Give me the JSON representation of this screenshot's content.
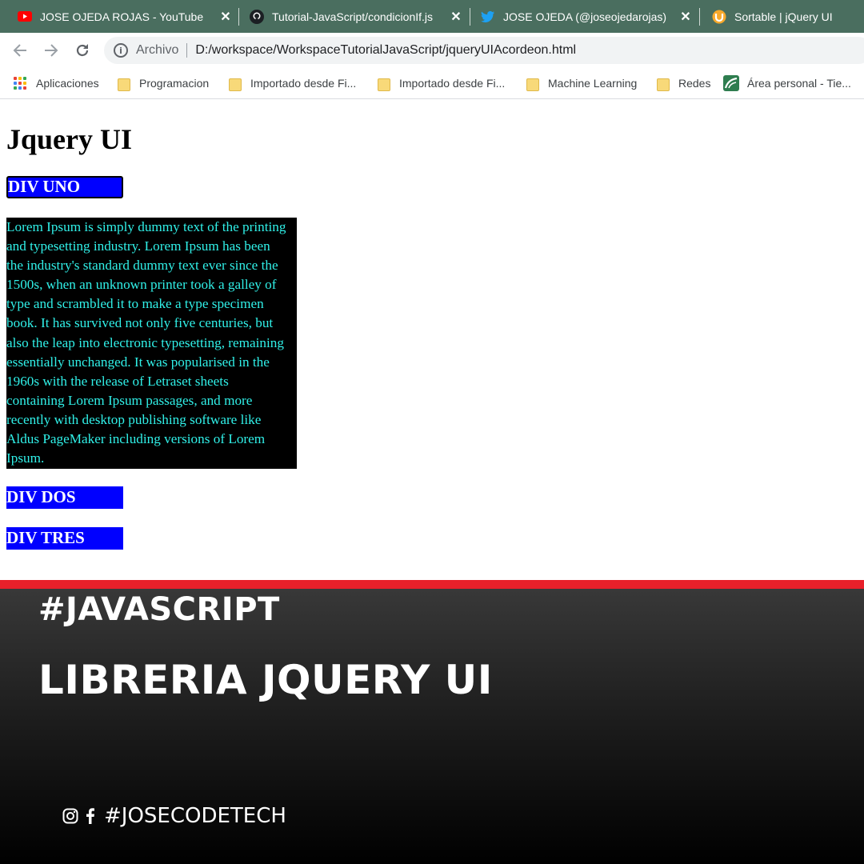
{
  "tabs": [
    {
      "title": "JOSE OJEDA ROJAS - YouTube",
      "icon": "youtube-icon"
    },
    {
      "title": "Tutorial-JavaScript/condicionIf.js",
      "icon": "github-icon"
    },
    {
      "title": "JOSE OJEDA (@joseojedarojas) / T",
      "icon": "twitter-icon"
    },
    {
      "title": "Sortable | jQuery UI",
      "icon": "jquery-ui-icon"
    }
  ],
  "address_bar": {
    "scheme_label": "Archivo",
    "url": "D:/workspace/WorkspaceTutorialJavaScript/jqueryUIAcordeon.html"
  },
  "bookmarks": [
    {
      "label": "Aplicaciones",
      "icon": "apps-grid-icon"
    },
    {
      "label": "Programacion",
      "icon": "folder-icon"
    },
    {
      "label": "Importado desde Fi...",
      "icon": "folder-icon"
    },
    {
      "label": "Importado desde Fi...",
      "icon": "folder-icon"
    },
    {
      "label": "Machine Learning",
      "icon": "folder-icon"
    },
    {
      "label": "Redes",
      "icon": "folder-icon"
    },
    {
      "label": "Área personal - Tie...",
      "icon": "moodle-icon"
    }
  ],
  "page": {
    "heading": "Jquery UI",
    "accordion": [
      {
        "header": "DIV UNO",
        "expanded": true
      },
      {
        "header": "DIV DOS",
        "expanded": false
      },
      {
        "header": "DIV TRES",
        "expanded": false
      }
    ],
    "panel_lines": [
      "Lorem Ipsum is simply dummy text of the printing",
      "and typesetting industry. Lorem Ipsum has been",
      "the industry's standard dummy text ever since the",
      "1500s, when an unknown printer took a galley of",
      "type and scrambled it to make a type specimen",
      "book. It has survived not only five centuries, but",
      "also the leap into electronic typesetting, remaining",
      "essentially unchanged. It was popularised in the",
      "1960s with the release of Letraset sheets",
      "containing Lorem Ipsum passages, and more",
      "recently with desktop publishing software like",
      "Aldus PageMaker including versions of Lorem",
      "Ipsum."
    ]
  },
  "banner": {
    "hashtag": "#JAVASCRIPT",
    "headline": "LIBRERIA JQUERY UI",
    "social_handle": "#JOSECODETECH",
    "accent_color": "#e8202a"
  },
  "colors": {
    "tab_strip": "#4a6e5f",
    "accordion_header": "#0000ff",
    "panel_background": "#000000",
    "panel_text": "#30f0e8"
  }
}
